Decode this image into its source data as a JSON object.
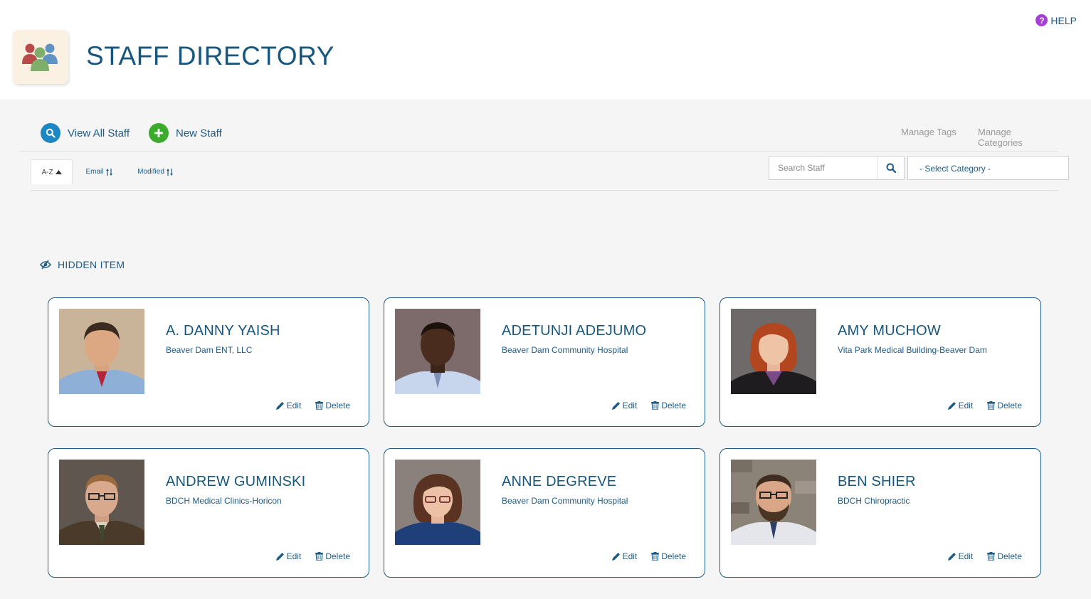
{
  "header": {
    "title": "STAFF DIRECTORY",
    "help_label": "HELP",
    "help_icon": "question-circle-icon",
    "app_icon": "people-group-icon"
  },
  "toolbar": {
    "view_all_label": "View All Staff",
    "new_staff_label": "New Staff",
    "manage_tags_label": "Manage Tags",
    "manage_categories_label": "Manage Categories"
  },
  "sort": {
    "az_label": "A-Z",
    "email_label": "Email",
    "modified_label": "Modified",
    "active": "A-Z"
  },
  "search": {
    "placeholder": "Search Staff",
    "category_value": "- Select Category -"
  },
  "section": {
    "hidden_label": "HIDDEN ITEM"
  },
  "labels": {
    "edit": "Edit",
    "delete": "Delete"
  },
  "colors": {
    "primary": "#1f5c85",
    "accent_blue": "#1d87c3",
    "accent_green": "#3aab2b",
    "help_purple": "#a63fd6"
  },
  "staff": [
    {
      "name": "A. DANNY YAISH",
      "org": "Beaver Dam ENT, LLC"
    },
    {
      "name": "ADETUNJI ADEJUMO",
      "org": "Beaver Dam Community Hospital"
    },
    {
      "name": "AMY MUCHOW",
      "org": "Vita Park Medical Building-Beaver Dam"
    },
    {
      "name": "ANDREW GUMINSKI",
      "org": "BDCH Medical Clinics-Horicon"
    },
    {
      "name": "ANNE DEGREVE",
      "org": "Beaver Dam Community Hospital"
    },
    {
      "name": "BEN SHIER",
      "org": "BDCH Chiropractic"
    }
  ]
}
